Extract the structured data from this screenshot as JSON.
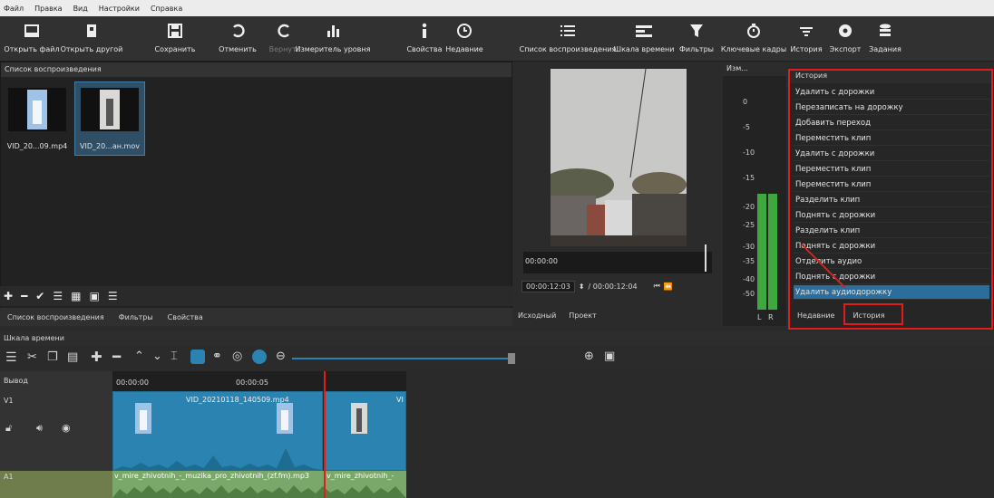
{
  "menubar": [
    "Файл",
    "Правка",
    "Вид",
    "Настройки",
    "Справка"
  ],
  "toolbar": [
    {
      "label": "Открыть файл",
      "icon": "open-file-icon",
      "dim": false
    },
    {
      "label": "Открыть другой",
      "icon": "open-other-icon",
      "dim": false
    },
    {
      "label": "Сохранить",
      "icon": "save-icon",
      "dim": false
    },
    {
      "label": "Отменить",
      "icon": "undo-icon",
      "dim": false
    },
    {
      "label": "Вернуть",
      "icon": "redo-icon",
      "dim": true
    },
    {
      "label": "Измеритель уровня",
      "icon": "level-meter-icon",
      "dim": false
    },
    {
      "label": "Свойства",
      "icon": "info-icon",
      "dim": false
    },
    {
      "label": "Недавние",
      "icon": "clock-icon",
      "dim": false
    },
    {
      "label": "Список воспроизведения",
      "icon": "list-icon",
      "dim": false
    },
    {
      "label": "Шкала времени",
      "icon": "timeline-icon",
      "dim": false
    },
    {
      "label": "Фильтры",
      "icon": "filter-icon",
      "dim": false
    },
    {
      "label": "Ключевые кадры",
      "icon": "stopwatch-icon",
      "dim": false
    },
    {
      "label": "История",
      "icon": "history-icon",
      "dim": false
    },
    {
      "label": "Экспорт",
      "icon": "export-icon",
      "dim": false
    },
    {
      "label": "Задания",
      "icon": "jobs-icon",
      "dim": false
    }
  ],
  "playlist": {
    "title": "Список воспроизведения",
    "items": [
      {
        "caption": "VID_20...09.mp4",
        "selected": false
      },
      {
        "caption": "VID_20...ан.mov",
        "selected": true
      }
    ],
    "tabs": [
      "Список воспроизведения",
      "Фильтры",
      "Свойства"
    ]
  },
  "viewer": {
    "scrub_time": "00:00:00",
    "current_time": "00:00:12:03",
    "total_time": "/ 00:00:12:04",
    "tabs": [
      "Исходный",
      "Проект"
    ]
  },
  "meter": {
    "title": "Изм...",
    "scale": [
      "0",
      "-5",
      "-10",
      "-15",
      "-20",
      "-25",
      "-30",
      "-35",
      "-40",
      "-50"
    ],
    "left_label": "L",
    "right_label": "R"
  },
  "history": {
    "title": "История",
    "items": [
      "Удалить с дорожки",
      "Перезаписать на дорожку",
      "Добавить переход",
      "Переместить клип",
      "Удалить с дорожки",
      "Переместить клип",
      "Переместить клип",
      "Разделить клип",
      "Поднять с дорожки",
      "Разделить клип",
      "Поднять с дорожки",
      "Отделить аудио",
      "Поднять с дорожки",
      "Удалить аудиодорожку"
    ],
    "active_index": 13,
    "tabs": [
      "Недавние",
      "История"
    ]
  },
  "timeline": {
    "title": "Шкала времени",
    "output_label": "Вывод",
    "video_track": "V1",
    "audio_track": "A1",
    "ruler": [
      "00:00:00",
      "00:00:05"
    ],
    "clip1_label": "VID_20210118_140509.mp4",
    "clip2_label": "VI",
    "audio_label": "v_mire_zhivotnih_-_muzika_pro_zhivotnih_(zf.fm).mp3",
    "audio_label2": "v_mire_zhivotnih_-"
  },
  "colors": {
    "highlight_red": "#e01c1c",
    "selection_blue": "#2b6e9b",
    "clip_blue": "#2a83b0",
    "audio_green": "#7aa86a"
  }
}
